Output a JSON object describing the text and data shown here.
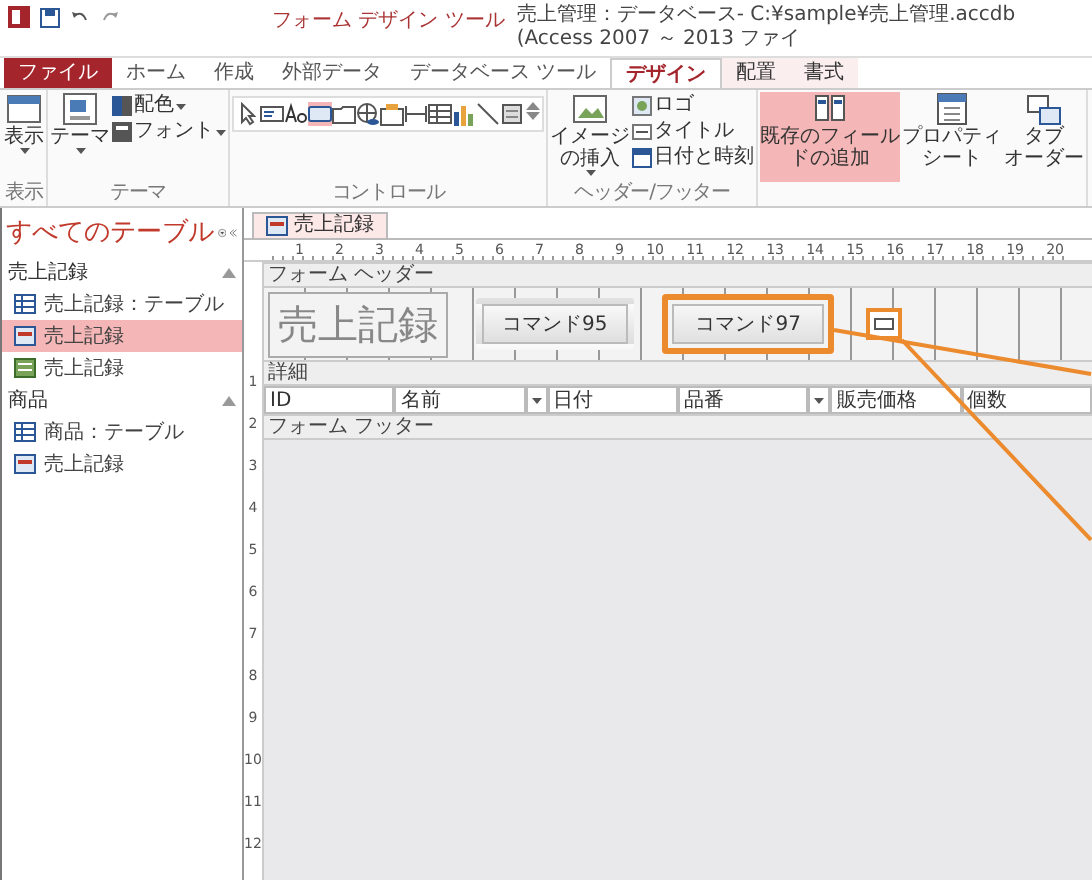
{
  "window": {
    "context_label": "フォーム デザイン ツール",
    "title": "売上管理：データベース- C:¥sample¥売上管理.accdb (Access 2007 ～ 2013 ファイ"
  },
  "tabs": [
    {
      "label": "ファイル",
      "kind": "file",
      "selected": false
    },
    {
      "label": "ホーム",
      "kind": "plain",
      "selected": false
    },
    {
      "label": "作成",
      "kind": "plain",
      "selected": false
    },
    {
      "label": "外部データ",
      "kind": "plain",
      "selected": false
    },
    {
      "label": "データベース ツール",
      "kind": "plain",
      "selected": false
    },
    {
      "label": "デザイン",
      "kind": "context",
      "selected": true
    },
    {
      "label": "配置",
      "kind": "context",
      "selected": false
    },
    {
      "label": "書式",
      "kind": "context",
      "selected": false
    }
  ],
  "ribbon": [
    {
      "label": "表示",
      "items": [
        {
          "kind": "big",
          "lines": [
            "表示"
          ],
          "dropdown": true,
          "highlighted": false
        }
      ]
    },
    {
      "label": "テーマ",
      "items": [
        {
          "kind": "big",
          "lines": [
            "テーマ"
          ],
          "dropdown": true,
          "highlighted": false
        },
        {
          "kind": "small",
          "label": "配色",
          "dropdown": true
        },
        {
          "kind": "small",
          "label": "フォント",
          "dropdown": true
        }
      ]
    },
    {
      "label": "コントロール",
      "items": [
        {
          "kind": "gallery",
          "controls": [
            {
              "kind": "pointer",
              "selected": false
            },
            {
              "kind": "textbox",
              "selected": false
            },
            {
              "kind": "label",
              "selected": false
            },
            {
              "kind": "button",
              "selected": true
            },
            {
              "kind": "tab",
              "selected": false
            },
            {
              "kind": "hyperlink",
              "selected": false
            },
            {
              "kind": "optiongroup",
              "selected": false
            },
            {
              "kind": "pagebreak",
              "selected": false
            },
            {
              "kind": "navigation",
              "selected": false
            },
            {
              "kind": "chart",
              "selected": false
            },
            {
              "kind": "line",
              "selected": false
            },
            {
              "kind": "toggle",
              "selected": false
            }
          ]
        }
      ]
    },
    {
      "label": "ヘッダー/フッター",
      "items": [
        {
          "kind": "big",
          "lines": [
            "イメージ",
            "の挿入"
          ],
          "dropdown": true,
          "highlighted": false
        },
        {
          "kind": "small",
          "label": "ロゴ",
          "dropdown": false
        },
        {
          "kind": "small",
          "label": "タイトル",
          "dropdown": false
        },
        {
          "kind": "small",
          "label": "日付と時刻",
          "dropdown": false
        }
      ]
    },
    {
      "items": [
        {
          "kind": "big",
          "lines": [
            "既存のフィール",
            "ドの追加"
          ],
          "dropdown": false,
          "highlighted": true
        },
        {
          "kind": "big",
          "lines": [
            "プロパティ",
            "シート"
          ],
          "dropdown": false,
          "highlighted": false
        },
        {
          "kind": "big",
          "lines": [
            "タブ",
            "オーダー"
          ],
          "dropdown": false,
          "highlighted": false
        }
      ]
    }
  ],
  "nav": {
    "title": "すべてのテーブル",
    "groups": [
      {
        "label": "売上記録",
        "expanded": true,
        "items": [
          {
            "label": "売上記録：テーブル",
            "kind": "table",
            "selected": false
          },
          {
            "label": "売上記録",
            "kind": "form",
            "selected": true
          },
          {
            "label": "売上記録",
            "kind": "report",
            "selected": false
          }
        ]
      },
      {
        "label": "商品",
        "expanded": true,
        "items": [
          {
            "label": "商品：テーブル",
            "kind": "table",
            "selected": false
          },
          {
            "label": "売上記録",
            "kind": "form",
            "selected": false
          }
        ]
      }
    ]
  },
  "document_tab": {
    "label": "売上記録",
    "selected": true
  },
  "ruler": {
    "horizontal": [
      "1",
      "2",
      "3",
      "4",
      "5",
      "6",
      "7",
      "8",
      "9",
      "10",
      "11",
      "12",
      "13",
      "14",
      "15",
      "16",
      "17",
      "18",
      "19",
      "20"
    ],
    "vertical": [
      "1",
      "2",
      "3",
      "4",
      "5",
      "6",
      "7",
      "8",
      "9",
      "10",
      "11",
      "12"
    ]
  },
  "sections": [
    {
      "kind": "header",
      "label": "フォーム ヘッダー",
      "controls": [
        {
          "kind": "title",
          "text": "売上記録",
          "selected": false
        },
        {
          "kind": "button",
          "text": "コマンド95",
          "selected": false
        },
        {
          "kind": "button",
          "text": "コマンド97",
          "selected": true
        },
        {
          "kind": "new",
          "selected": true
        }
      ]
    },
    {
      "kind": "detail",
      "label": "詳細",
      "controls": [
        {
          "kind": "textbox",
          "text": "ID",
          "dropdown": false
        },
        {
          "kind": "textbox",
          "text": "名前",
          "dropdown": true
        },
        {
          "kind": "textbox",
          "text": "日付",
          "dropdown": false
        },
        {
          "kind": "textbox",
          "text": "品番",
          "dropdown": true
        },
        {
          "kind": "textbox",
          "text": "販売価格",
          "dropdown": false
        },
        {
          "kind": "textbox",
          "text": "個数",
          "dropdown": false
        }
      ]
    },
    {
      "kind": "footer",
      "label": "フォーム フッター"
    }
  ]
}
